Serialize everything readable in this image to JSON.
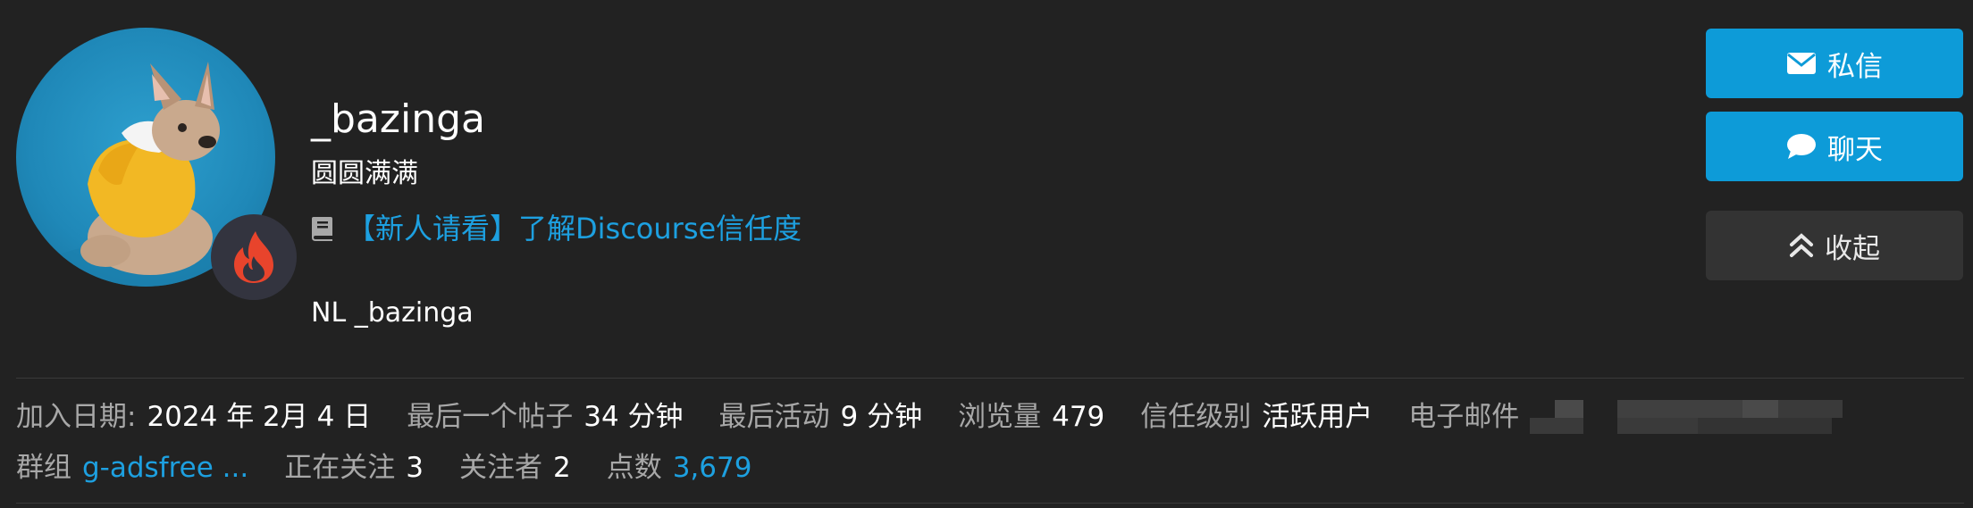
{
  "profile": {
    "username": "_bazinga",
    "title": "圆圆满满",
    "featured_topic": "【新人请看】了解Discourse信任度",
    "bio": "NL _bazinga",
    "avatar_icon": "avatar-dog-photo",
    "flair_icon": "flame-icon",
    "flair_color": "#e8442c"
  },
  "actions": {
    "message_label": "私信",
    "chat_label": "聊天",
    "collapse_label": "收起"
  },
  "stats": {
    "joined_label": "加入日期:",
    "joined_value": "2024 年 2月 4 日",
    "last_post_label": "最后一个帖子",
    "last_post_value": "34 分钟",
    "last_seen_label": "最后活动",
    "last_seen_value": "9 分钟",
    "views_label": "浏览量",
    "views_value": "479",
    "trust_label": "信任级别",
    "trust_value": "活跃用户",
    "email_label": "电子邮件",
    "groups_label": "群组",
    "groups_value": "g-adsfree ...",
    "following_label": "正在关注",
    "following_value": "3",
    "followers_label": "关注者",
    "followers_value": "2",
    "points_label": "点数",
    "points_value": "3,679"
  },
  "colors": {
    "accent": "#0d9bd8",
    "link": "#1da0e0",
    "background": "#222222"
  }
}
